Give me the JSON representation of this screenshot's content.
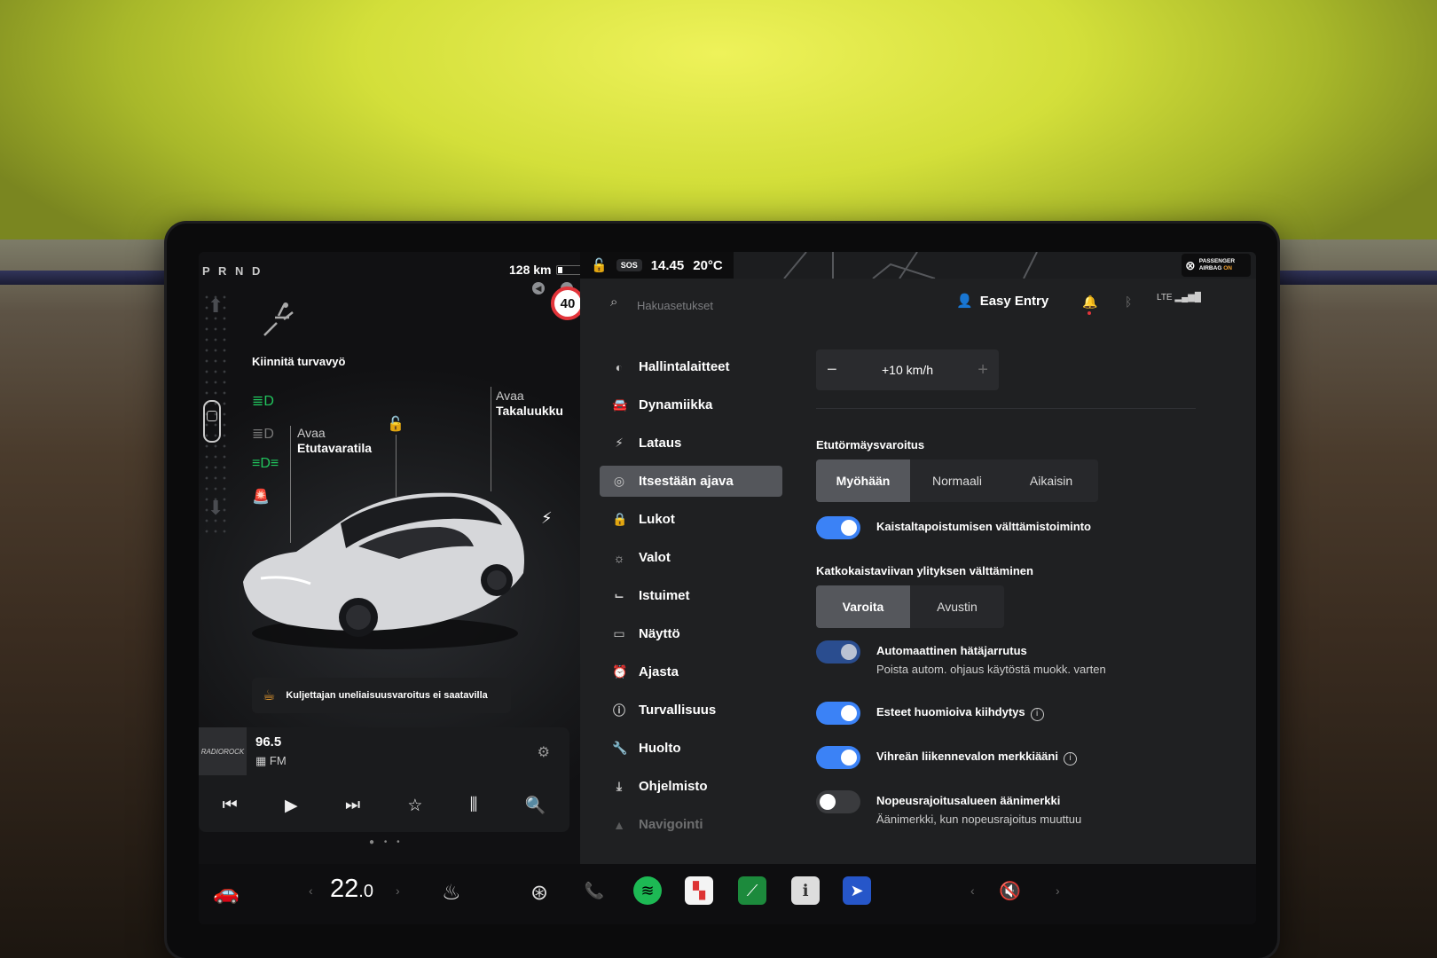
{
  "left_panel": {
    "gear": "P R N D",
    "range": "128 km",
    "speed_limit": "40",
    "seatbelt_text": "Kiinnitä turvavyö",
    "frunk_line1": "Avaa",
    "frunk_line2": "Etutavaratila",
    "trunk_line1": "Avaa",
    "trunk_line2": "Takaluukku",
    "warning": "Kuljettajan uneliaisuusvaroitus ei saatavilla"
  },
  "media": {
    "station_logo": "RADIOROCK",
    "frequency": "96.5",
    "band": "FM"
  },
  "topbar": {
    "sos": "SOS",
    "time": "14.45",
    "outside_temp": "20°C",
    "airbag_line1": "PASSENGER",
    "airbag_line2": "AIRBAG",
    "airbag_state": "ON"
  },
  "header": {
    "search_placeholder": "Hakuasetukset",
    "profile": "Easy Entry",
    "signal_label": "LTE"
  },
  "menu": [
    {
      "label": "Hallintalaitteet",
      "icon": "toggle-icon"
    },
    {
      "label": "Dynamiikka",
      "icon": "car-icon"
    },
    {
      "label": "Lataus",
      "icon": "bolt-icon"
    },
    {
      "label": "Itsestään ajava",
      "icon": "steering-wheel-icon",
      "active": true
    },
    {
      "label": "Lukot",
      "icon": "lock-icon"
    },
    {
      "label": "Valot",
      "icon": "sun-icon"
    },
    {
      "label": "Istuimet",
      "icon": "seat-icon"
    },
    {
      "label": "Näyttö",
      "icon": "display-icon"
    },
    {
      "label": "Ajasta",
      "icon": "alarm-icon"
    },
    {
      "label": "Turvallisuus",
      "icon": "info-circle-icon"
    },
    {
      "label": "Huolto",
      "icon": "wrench-icon"
    },
    {
      "label": "Ohjelmisto",
      "icon": "download-icon"
    },
    {
      "label": "Navigointi",
      "icon": "navigation-icon"
    }
  ],
  "content": {
    "speed_offset": "+10 km/h",
    "fcw_title": "Etutörmäysvaroitus",
    "fcw_options": [
      "Myöhään",
      "Normaali",
      "Aikaisin"
    ],
    "fcw_selected": "Myöhään",
    "lane_departure": "Kaistaltapoistumisen välttämistoiminto",
    "blind_title": "Katkokaistaviivan ylityksen välttäminen",
    "blind_options": [
      "Varoita",
      "Avustin"
    ],
    "blind_selected": "Varoita",
    "aeb_title": "Automaattinen hätäjarrutus",
    "aeb_sub": "Poista autom. ohjaus käytöstä muokk. varten",
    "obstacle_accel": "Esteet huomioiva kiihdytys",
    "green_light": "Vihreän liikennevalon merkkiääni",
    "speed_zone_title": "Nopeusrajoitusalueen äänimerkki",
    "speed_zone_sub": "Äänimerkki, kun nopeusrajoitus muuttuu"
  },
  "dock": {
    "cabin_temp": "22",
    "cabin_temp_decimal": ".0"
  },
  "colors": {
    "accent": "#3b82f6",
    "warning": "#e2343a",
    "amber": "#f0a030",
    "green_indicator": "#21c55d"
  }
}
